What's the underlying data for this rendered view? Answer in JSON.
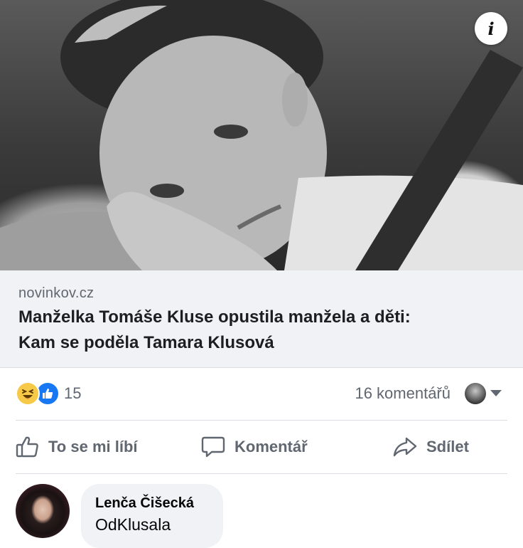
{
  "post": {
    "image": {
      "icon": "info-icon",
      "info_label": "i"
    },
    "link": {
      "domain": "novinkov.cz",
      "title_line1": "Manželka Tomáše Kluse opustila manžela a děti:",
      "title_line2": "Kam se poděla Tamara Klusová"
    },
    "stats": {
      "reaction_icons": [
        "haha-icon",
        "like-icon"
      ],
      "reaction_count": "15",
      "comments_label": "16 komentářů"
    },
    "actions": {
      "like_label": "To se mi líbí",
      "comment_label": "Komentář",
      "share_label": "Sdílet"
    }
  },
  "comment": {
    "author": "Lenča Čišecká",
    "text": "OdKlusala"
  },
  "colors": {
    "link_box_bg": "#f0f2f5",
    "secondary_text": "#606770",
    "like_blue": "#1877f2",
    "haha_yellow": "#f7c948"
  }
}
